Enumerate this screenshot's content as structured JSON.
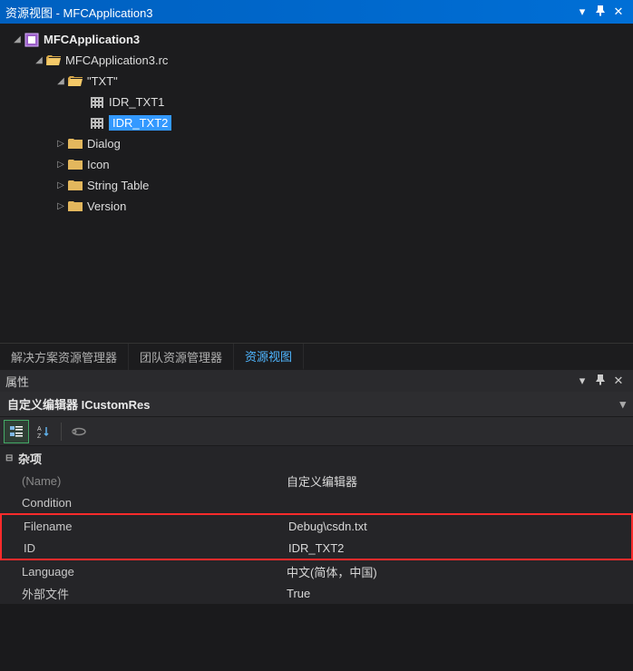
{
  "resourcePanel": {
    "title": "资源视图 - MFCApplication3",
    "tree": {
      "root": "MFCApplication3",
      "rc": "MFCApplication3.rc",
      "txtFolder": "\"TXT\"",
      "txt1": "IDR_TXT1",
      "txt2": "IDR_TXT2",
      "dialog": "Dialog",
      "icon": "Icon",
      "stringTable": "String Table",
      "version": "Version"
    }
  },
  "tabs": {
    "t1": "解决方案资源管理器",
    "t2": "团队资源管理器",
    "t3": "资源视图"
  },
  "propertiesPanel": {
    "title": "属性",
    "header": "自定义编辑器 ICustomRes",
    "category": "杂项",
    "rows": {
      "name": {
        "k": "(Name)",
        "v": "自定义编辑器"
      },
      "condition": {
        "k": "Condition",
        "v": ""
      },
      "filename": {
        "k": "Filename",
        "v": "Debug\\csdn.txt"
      },
      "id": {
        "k": "ID",
        "v": "IDR_TXT2"
      },
      "language": {
        "k": "Language",
        "v": "中文(简体，中国)"
      },
      "external": {
        "k": "外部文件",
        "v": "True"
      }
    }
  },
  "icons": {
    "dropdown": "▾",
    "pin": "⊓",
    "close": "✕",
    "exp_open": "◢",
    "exp_closed": "▷",
    "minus": "⊟"
  }
}
